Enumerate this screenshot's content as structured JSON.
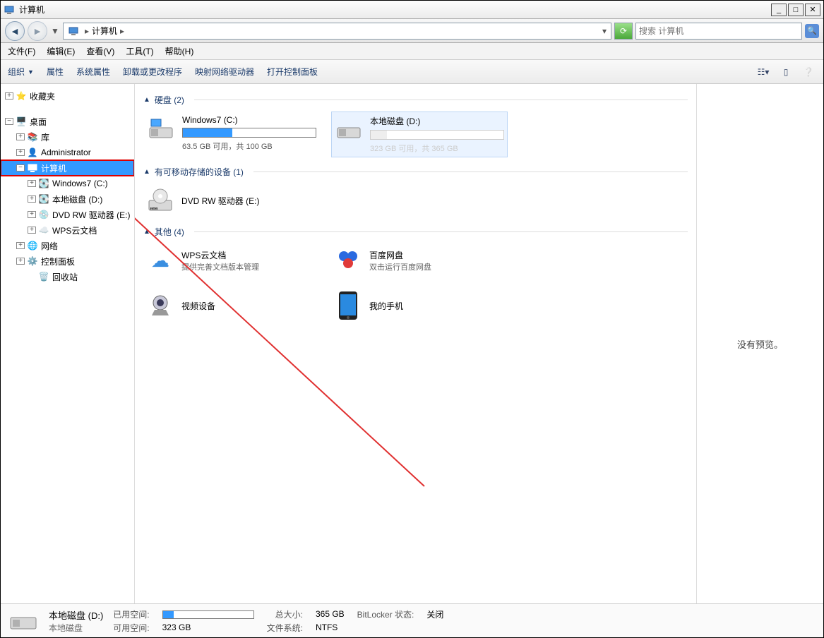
{
  "window": {
    "title": "计算机"
  },
  "nav": {
    "location": "计算机"
  },
  "search": {
    "placeholder": "搜索 计算机"
  },
  "menubar": [
    "文件(F)",
    "编辑(E)",
    "查看(V)",
    "工具(T)",
    "帮助(H)"
  ],
  "toolbar": {
    "organize": "组织",
    "properties": "属性",
    "sysprops": "系统属性",
    "uninstall": "卸载或更改程序",
    "mapdrive": "映射网络驱动器",
    "controlpanel": "打开控制面板"
  },
  "tree": {
    "favorites": "收藏夹",
    "desktop": "桌面",
    "libraries": "库",
    "admin": "Administrator",
    "computer": "计算机",
    "cdrive": "Windows7 (C:)",
    "ddrive": "本地磁盘 (D:)",
    "dvd": "DVD RW 驱动器 (E:)",
    "wps": "WPS云文档",
    "network": "网络",
    "cpanel": "控制面板",
    "recycle": "回收站"
  },
  "sections": {
    "drives": "硬盘 (2)",
    "removable": "有可移动存储的设备 (1)",
    "other": "其他 (4)"
  },
  "drives": {
    "c": {
      "name": "Windows7 (C:)",
      "sub": "63.5 GB 可用，共 100 GB",
      "fill": 37
    },
    "d": {
      "name": "本地磁盘 (D:)",
      "sub": "323 GB 可用，共 365 GB",
      "fill": 12
    }
  },
  "removable": {
    "dvd": {
      "name": "DVD RW 驱动器 (E:)"
    }
  },
  "others": {
    "wps": {
      "name": "WPS云文档",
      "sub": "提供完善文档版本管理"
    },
    "baidu": {
      "name": "百度网盘",
      "sub": "双击运行百度网盘"
    },
    "video": {
      "name": "视频设备"
    },
    "phone": {
      "name": "我的手机"
    }
  },
  "preview": {
    "text": "没有预览。"
  },
  "status": {
    "title": "本地磁盘 (D:)",
    "type": "本地磁盘",
    "used_label": "已用空间:",
    "used_fill": 12,
    "free_label": "可用空间:",
    "free_val": "323 GB",
    "total_label": "总大小:",
    "total_val": "365 GB",
    "fs_label": "文件系统:",
    "fs_val": "NTFS",
    "bitlocker_label": "BitLocker 状态:",
    "bitlocker_val": "关闭"
  }
}
